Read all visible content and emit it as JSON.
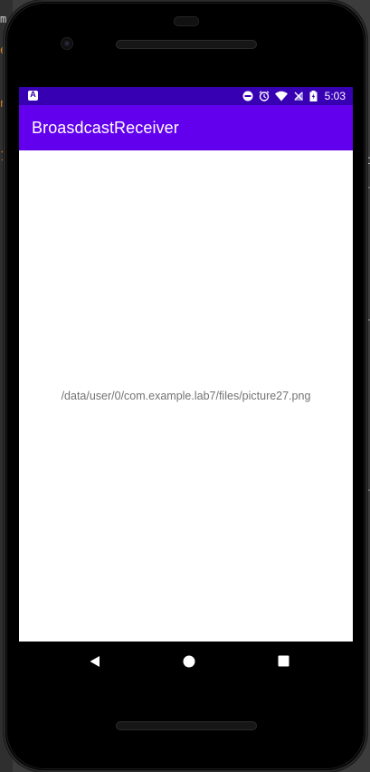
{
  "background": {
    "fragments": [
      "m",
      "e",
      "n",
      "1",
      "c"
    ]
  },
  "status_bar": {
    "left_icon_letter": "A",
    "icons": [
      "do-not-disturb-icon",
      "alarm-icon",
      "wifi-icon",
      "cell-signal-off-icon",
      "battery-charging-icon"
    ],
    "time": "5:03"
  },
  "app_bar": {
    "title": "BroasdcastReceiver"
  },
  "content": {
    "path_text": "/data/user/0/com.example.lab7/files/picture27.png"
  },
  "nav_bar": {
    "buttons": [
      "back",
      "home",
      "recents"
    ]
  },
  "colors": {
    "status_bar": "#3700b3",
    "app_bar": "#6200ee",
    "screen_bg": "#ffffff",
    "text_secondary": "#737373"
  }
}
